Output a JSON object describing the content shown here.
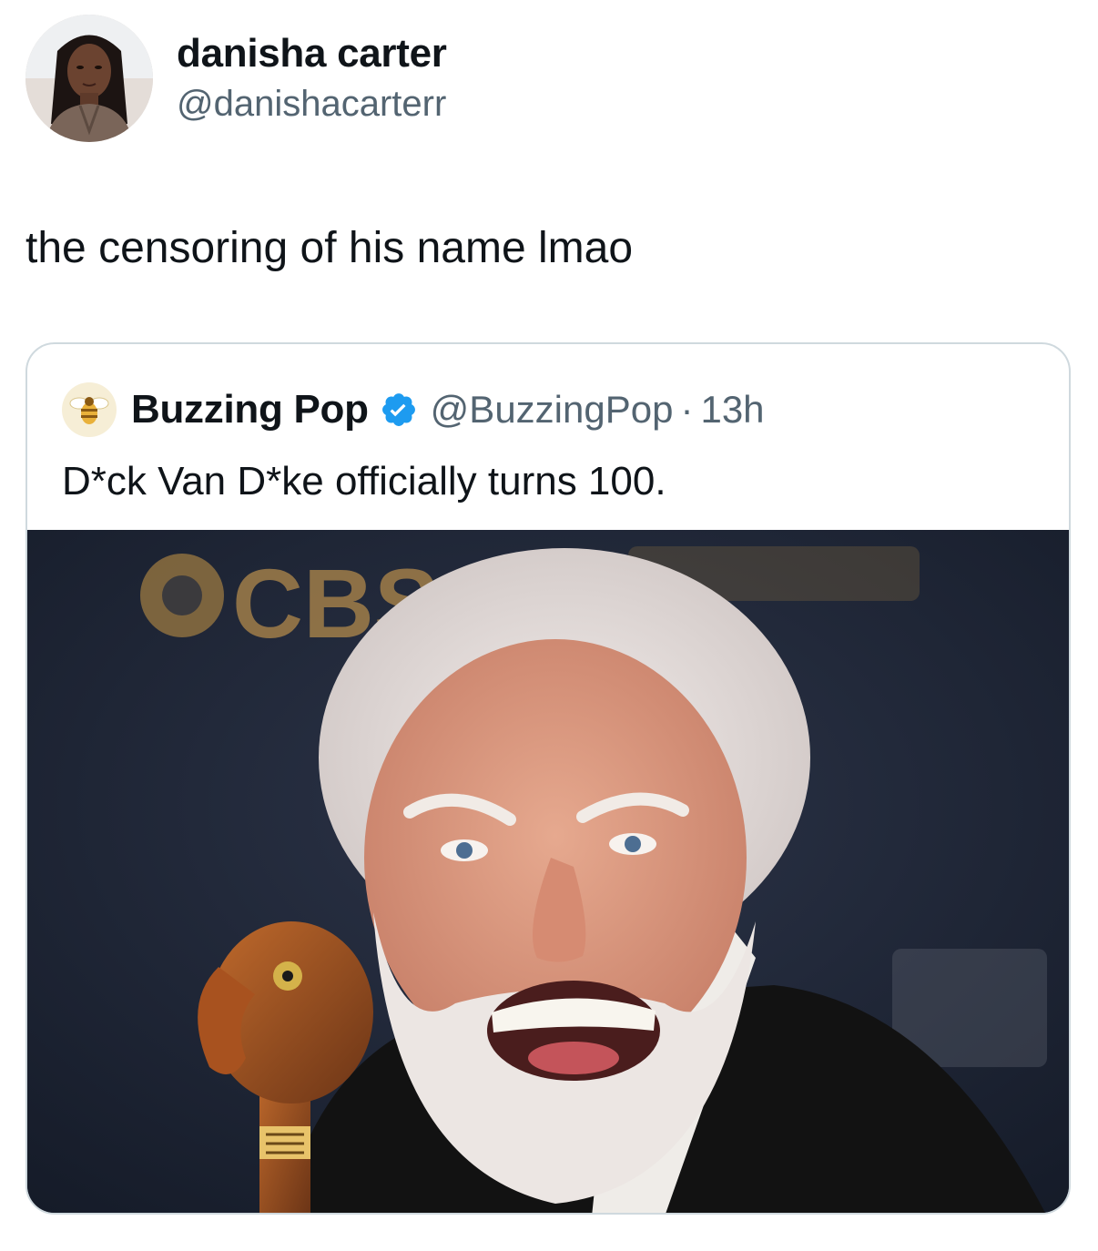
{
  "post": {
    "author": {
      "display_name": "danisha carter",
      "handle": "@danishacarterr",
      "avatar_icon": "profile-photo"
    },
    "text": "the censoring of his name lmao"
  },
  "quoted_post": {
    "author": {
      "display_name": "Buzzing Pop",
      "handle": "@BuzzingPop",
      "separator": "·",
      "time": "13h",
      "verified": true,
      "avatar_icon": "bee-icon",
      "verified_icon": "verified-badge-icon",
      "verified_color": "#1d9bf0"
    },
    "text": "D*ck Van D*ke officially turns 100.",
    "media": {
      "type": "photo",
      "backdrop_text": "CBS"
    }
  }
}
